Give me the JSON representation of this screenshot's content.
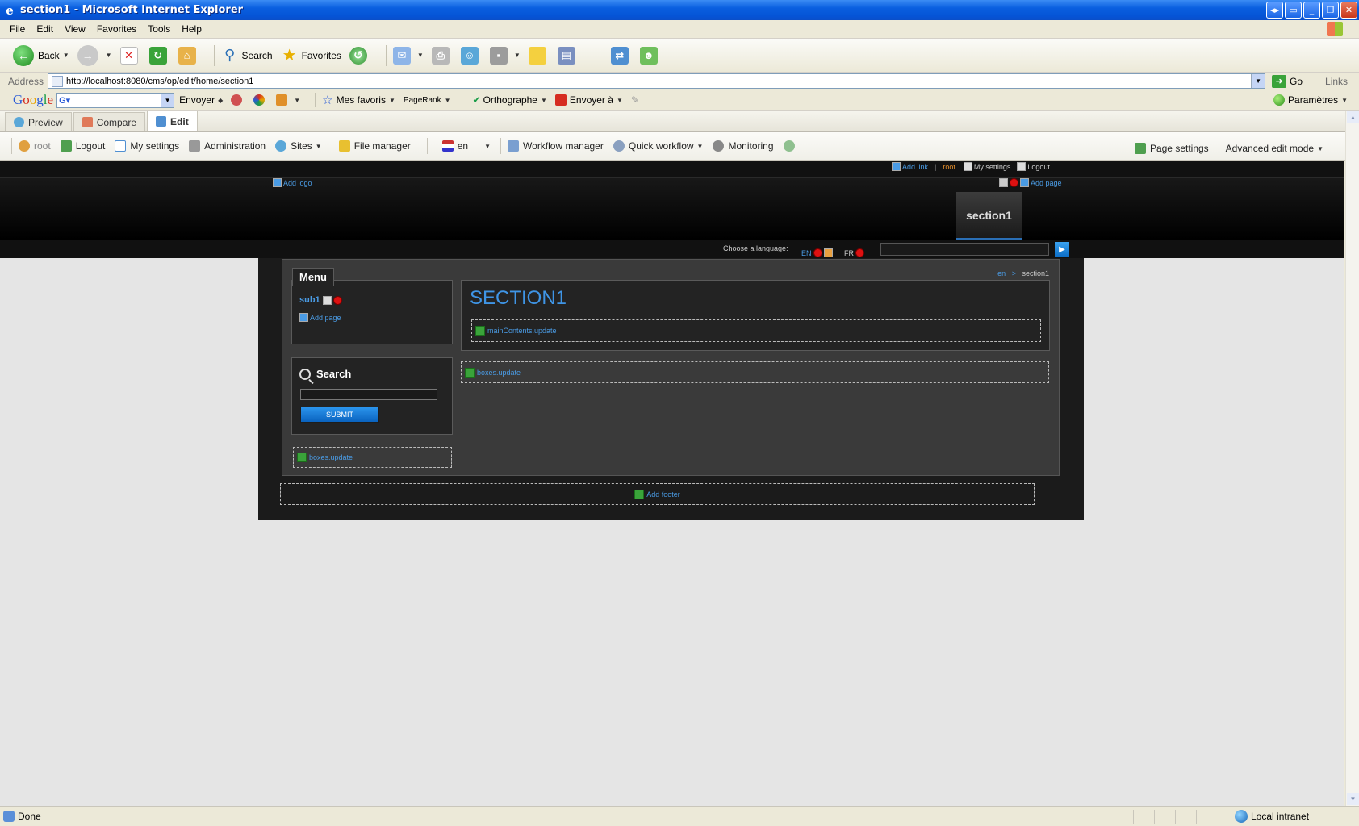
{
  "window": {
    "title": "section1 - Microsoft Internet Explorer"
  },
  "menubar": [
    "File",
    "Edit",
    "View",
    "Favorites",
    "Tools",
    "Help"
  ],
  "toolbar": {
    "back": "Back",
    "search": "Search",
    "favorites": "Favorites"
  },
  "address": {
    "label": "Address",
    "url": "http://localhost:8080/cms/op/edit/home/section1",
    "go": "Go",
    "links": "Links"
  },
  "google": {
    "envoyer": "Envoyer",
    "mes_favoris": "Mes favoris",
    "pagerank": "PageRank",
    "orthographe": "Orthographe",
    "envoyer_a": "Envoyer à",
    "parametres": "Paramètres"
  },
  "cms_tabs": {
    "preview": "Preview",
    "compare": "Compare",
    "edit": "Edit"
  },
  "cms_bar": {
    "user": "root",
    "logout": "Logout",
    "my_settings": "My settings",
    "administration": "Administration",
    "sites": "Sites",
    "file_manager": "File manager",
    "language": "en",
    "workflow_manager": "Workflow manager",
    "quick_workflow": "Quick workflow",
    "monitoring": "Monitoring",
    "page_settings": "Page settings",
    "advanced_edit_mode": "Advanced edit mode"
  },
  "site": {
    "add_link": "Add link",
    "user": "root",
    "my_settings": "My settings",
    "logout": "Logout",
    "add_logo": "Add logo",
    "add_page": "Add page",
    "nav_tab": "section1",
    "choose_language": "Choose a language:",
    "lang_en": "EN",
    "lang_fr": "FR",
    "breadcrumb_root": "en",
    "breadcrumb_sep": ">",
    "breadcrumb_current": "section1",
    "menu_title": "Menu",
    "menu_item": "sub1",
    "menu_add_page": "Add page",
    "search_title": "Search",
    "submit": "SUBMIT",
    "boxes_update": "boxes.update",
    "section_title": "SECTION1",
    "main_contents": "mainContents.update",
    "add_footer": "Add footer"
  },
  "status": {
    "text": "Done",
    "zone": "Local intranet"
  },
  "colors": {
    "link_blue": "#4a9be4",
    "title_blue": "#3f95e6",
    "xp_blue": "#0554d6"
  }
}
